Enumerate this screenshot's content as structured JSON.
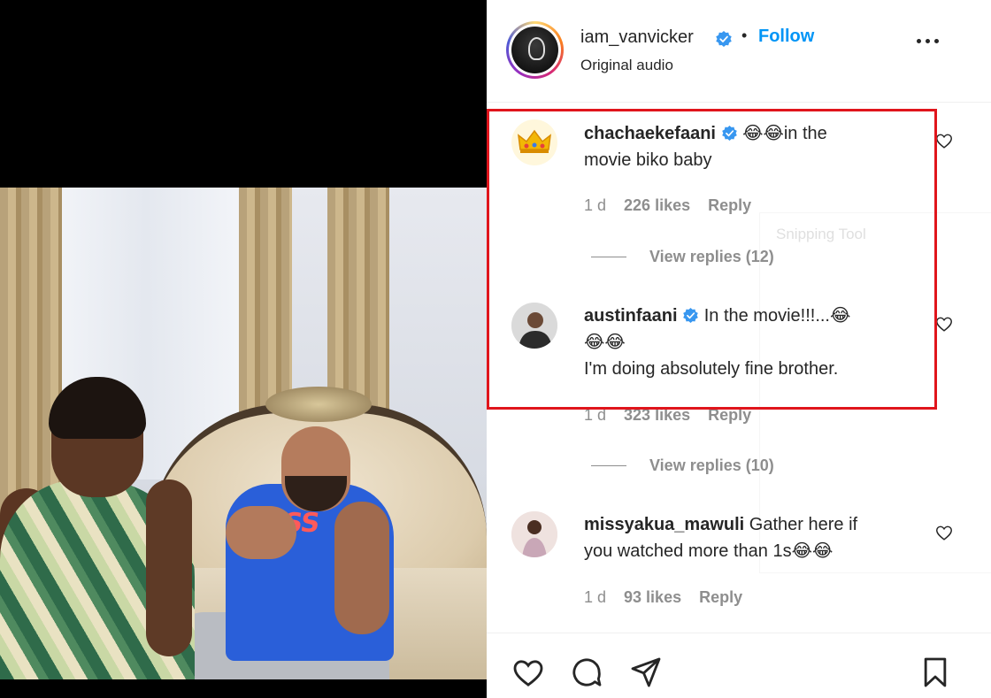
{
  "post": {
    "username": "iam_vanvicker",
    "separator": "•",
    "follow_label": "Follow",
    "audio_label": "Original audio"
  },
  "comments": [
    {
      "username": "chachaekefaani",
      "text_line1": "😂😂in the",
      "text_line2": "movie biko baby",
      "time": "1 d",
      "likes": "226 likes",
      "reply_label": "Reply",
      "view_replies": "View replies (12)"
    },
    {
      "username": "austinfaani",
      "text_line1": "In the movie!!!...😂",
      "text_line2": "😂😂",
      "text_line3": "I'm doing absolutely fine brother.",
      "time": "1 d",
      "likes": "323 likes",
      "reply_label": "Reply",
      "view_replies": "View replies (10)"
    },
    {
      "username": "missyakua_mawuli",
      "text_line1": "Gather here if",
      "text_line2": "you watched more than 1s😂😂",
      "time": "1 d",
      "likes": "93 likes",
      "reply_label": "Reply"
    }
  ],
  "overlay": {
    "snipping_tool_label": "Snipping Tool"
  },
  "video": {
    "shirt_text": "OSS"
  },
  "icons": {
    "like": "heart-icon",
    "comment": "comment-icon",
    "share": "send-icon",
    "save": "bookmark-icon",
    "verified": "verified-badge-icon",
    "more": "more-options-icon"
  },
  "colors": {
    "accent": "#0095f6",
    "highlight": "#e0151c",
    "muted": "#8e8e8e",
    "text": "#262626"
  }
}
